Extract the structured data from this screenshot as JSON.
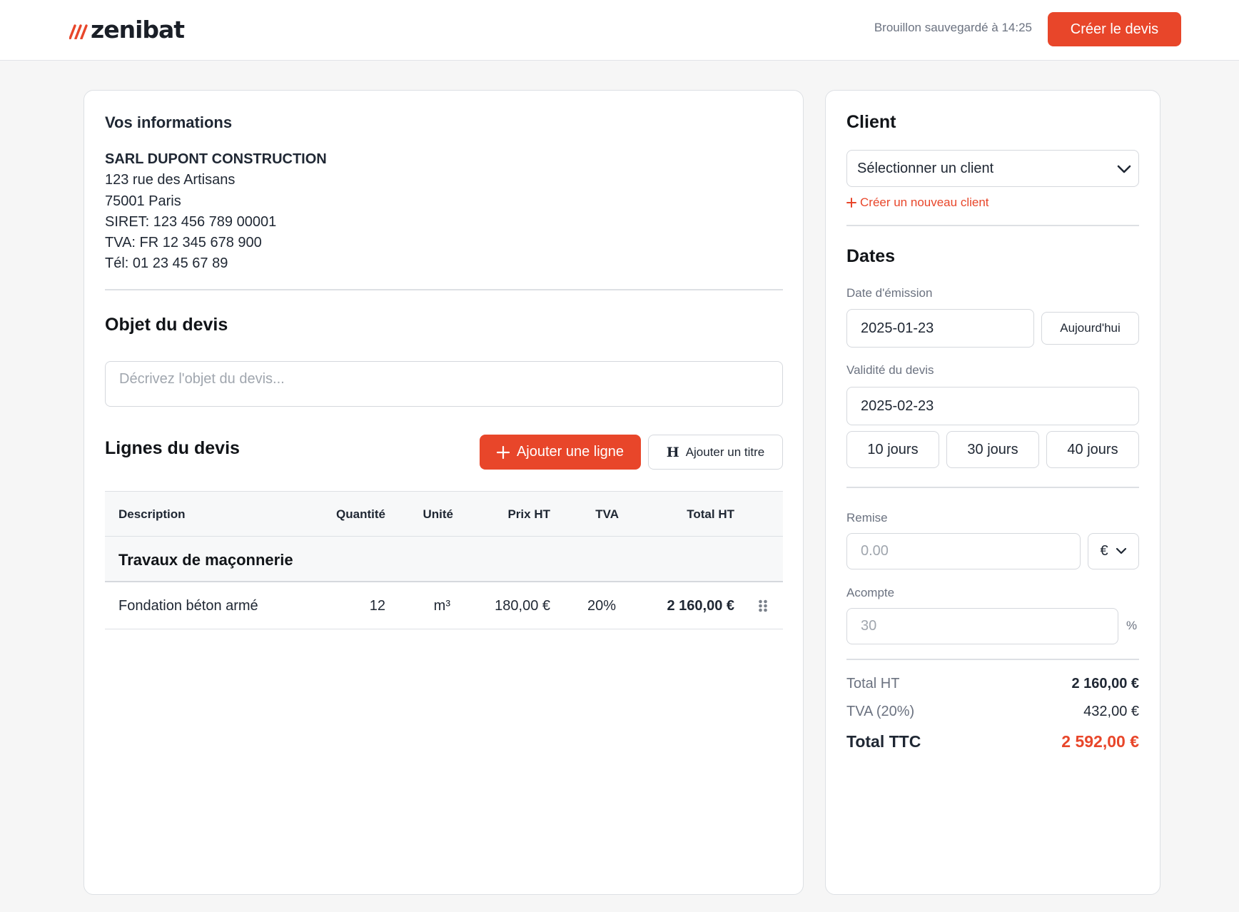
{
  "header": {
    "brand": "zenibat",
    "draft_status": "Brouillon sauvegardé à 14:25",
    "create_button": "Créer le devis"
  },
  "company": {
    "section_title": "Vos informations",
    "name": "SARL DUPONT CONSTRUCTION",
    "address": "123 rue des Artisans",
    "city": "75001 Paris",
    "siret": "SIRET: 123 456 789 00001",
    "tva": "TVA: FR 12 345 678 900",
    "phone": "Tél: 01 23 45 67 89"
  },
  "object": {
    "title": "Objet du devis",
    "placeholder": "Décrivez l'objet du devis..."
  },
  "lines": {
    "title": "Lignes du devis",
    "add_line": "Ajouter une ligne",
    "add_title": "Ajouter un titre",
    "add_title_glyph": "H",
    "columns": {
      "description": "Description",
      "quantity": "Quantité",
      "unit": "Unité",
      "price": "Prix HT",
      "tva": "TVA",
      "total": "Total HT"
    },
    "section_label": "Travaux de maçonnerie",
    "rows": [
      {
        "description": "Fondation béton armé",
        "quantity": "12",
        "unit": "m³",
        "price": "180,00 €",
        "tva": "20%",
        "total": "2 160,00 €"
      }
    ]
  },
  "client": {
    "title": "Client",
    "select_value": "Sélectionner un client",
    "create_link": "Créer un nouveau client"
  },
  "dates": {
    "title": "Dates",
    "issue_label": "Date d'émission",
    "issue_value": "2025-01-23",
    "today_button": "Aujourd'hui",
    "validity_label": "Validité du devis",
    "validity_value": "2025-02-23",
    "presets": [
      "10 jours",
      "30 jours",
      "40 jours"
    ]
  },
  "discount": {
    "label": "Remise",
    "placeholder": "0.00",
    "currency": "€"
  },
  "deposit": {
    "label": "Acompte",
    "placeholder": "30",
    "unit": "%"
  },
  "summary": {
    "total_ht_label": "Total HT",
    "total_ht_value": "2 160,00 €",
    "tva_label": "TVA (20%)",
    "tva_value": "432,00 €",
    "total_ttc_label": "Total TTC",
    "total_ttc_value": "2 592,00 €"
  },
  "colors": {
    "accent": "#e8462a",
    "text": "#1f2733",
    "muted": "#6b7280",
    "border": "#dde0e4"
  }
}
